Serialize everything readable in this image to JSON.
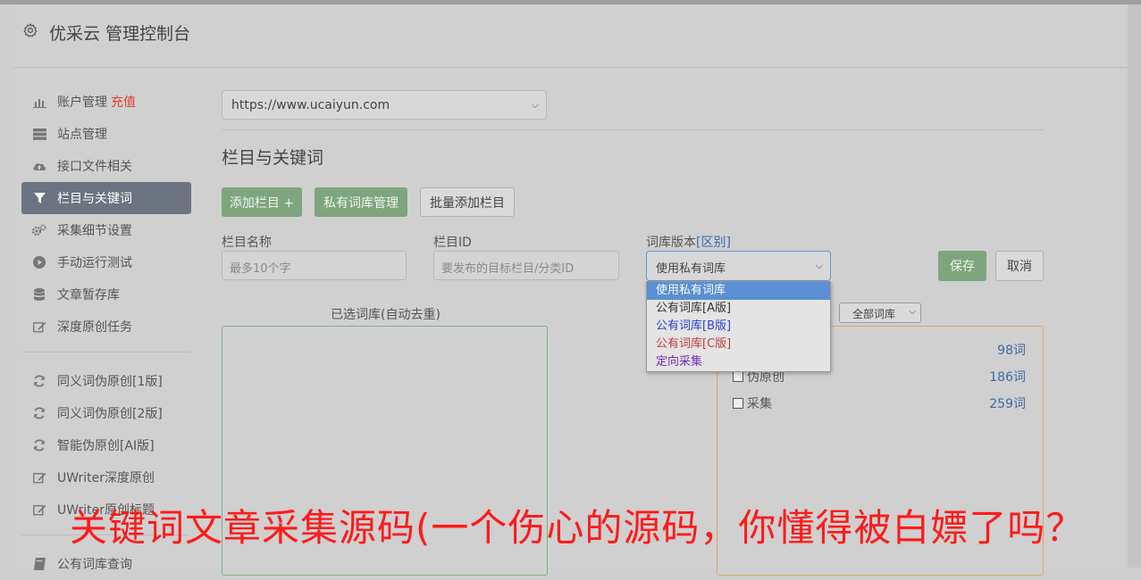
{
  "app": {
    "title": "优采云 管理控制台"
  },
  "sidebar": {
    "items": [
      {
        "icon": "bar-chart-icon",
        "label": "账户管理",
        "badge": "充值"
      },
      {
        "icon": "server-icon",
        "label": "站点管理"
      },
      {
        "icon": "cloud-upload-icon",
        "label": "接口文件相关"
      },
      {
        "icon": "filter-icon",
        "label": "栏目与关键词",
        "active": true
      },
      {
        "icon": "cogs-icon",
        "label": "采集细节设置"
      },
      {
        "icon": "play-circle-icon",
        "label": "手动运行测试"
      },
      {
        "icon": "database-icon",
        "label": "文章暂存库"
      },
      {
        "icon": "edit-icon",
        "label": "深度原创任务"
      }
    ],
    "items2": [
      {
        "icon": "refresh-icon",
        "label": "同义词伪原创[1版]"
      },
      {
        "icon": "refresh-icon",
        "label": "同义词伪原创[2版]"
      },
      {
        "icon": "refresh-icon",
        "label": "智能伪原创[AI版]"
      },
      {
        "icon": "edit-icon",
        "label": "UWriter深度原创"
      },
      {
        "icon": "edit-icon",
        "label": "UWriter原创标题"
      }
    ],
    "items3": [
      {
        "icon": "book-icon",
        "label": "公有词库查询"
      }
    ]
  },
  "site_select": {
    "value": "https://www.ucaiyun.com"
  },
  "section": {
    "title": "栏目与关键词"
  },
  "buttons": {
    "add_column": "添加栏目 +",
    "private_lib": "私有词库管理",
    "batch_add": "批量添加栏目",
    "save": "保存",
    "cancel": "取消"
  },
  "form": {
    "name_label": "栏目名称",
    "name_placeholder": "最多10个字",
    "id_label": "栏目ID",
    "id_placeholder": "要发布的目标栏目/分类ID",
    "version_label": "词库版本",
    "version_link": "[区别]",
    "version_value": "使用私有词库"
  },
  "dropdown": {
    "options": [
      {
        "label": "使用私有词库",
        "color": "#ffffff",
        "selected": true
      },
      {
        "label": "公有词库[A版]",
        "color": "#333333"
      },
      {
        "label": "公有词库[B版]",
        "color": "#2b3fd6"
      },
      {
        "label": "公有词库[C版]",
        "color": "#c23b3b"
      },
      {
        "label": "定向采集",
        "color": "#7a2bb8"
      }
    ]
  },
  "panels": {
    "selected_title": "已选词库(自动去重)",
    "filter_value": "全部词库",
    "libs": [
      {
        "name": "",
        "count": "98词"
      },
      {
        "name": "伪原创",
        "count": "186词"
      },
      {
        "name": "采集",
        "count": "259词"
      }
    ]
  },
  "overlay": {
    "text": "关键词文章采集源码(一个伤心的源码，你懂得被白嫖了吗？"
  }
}
